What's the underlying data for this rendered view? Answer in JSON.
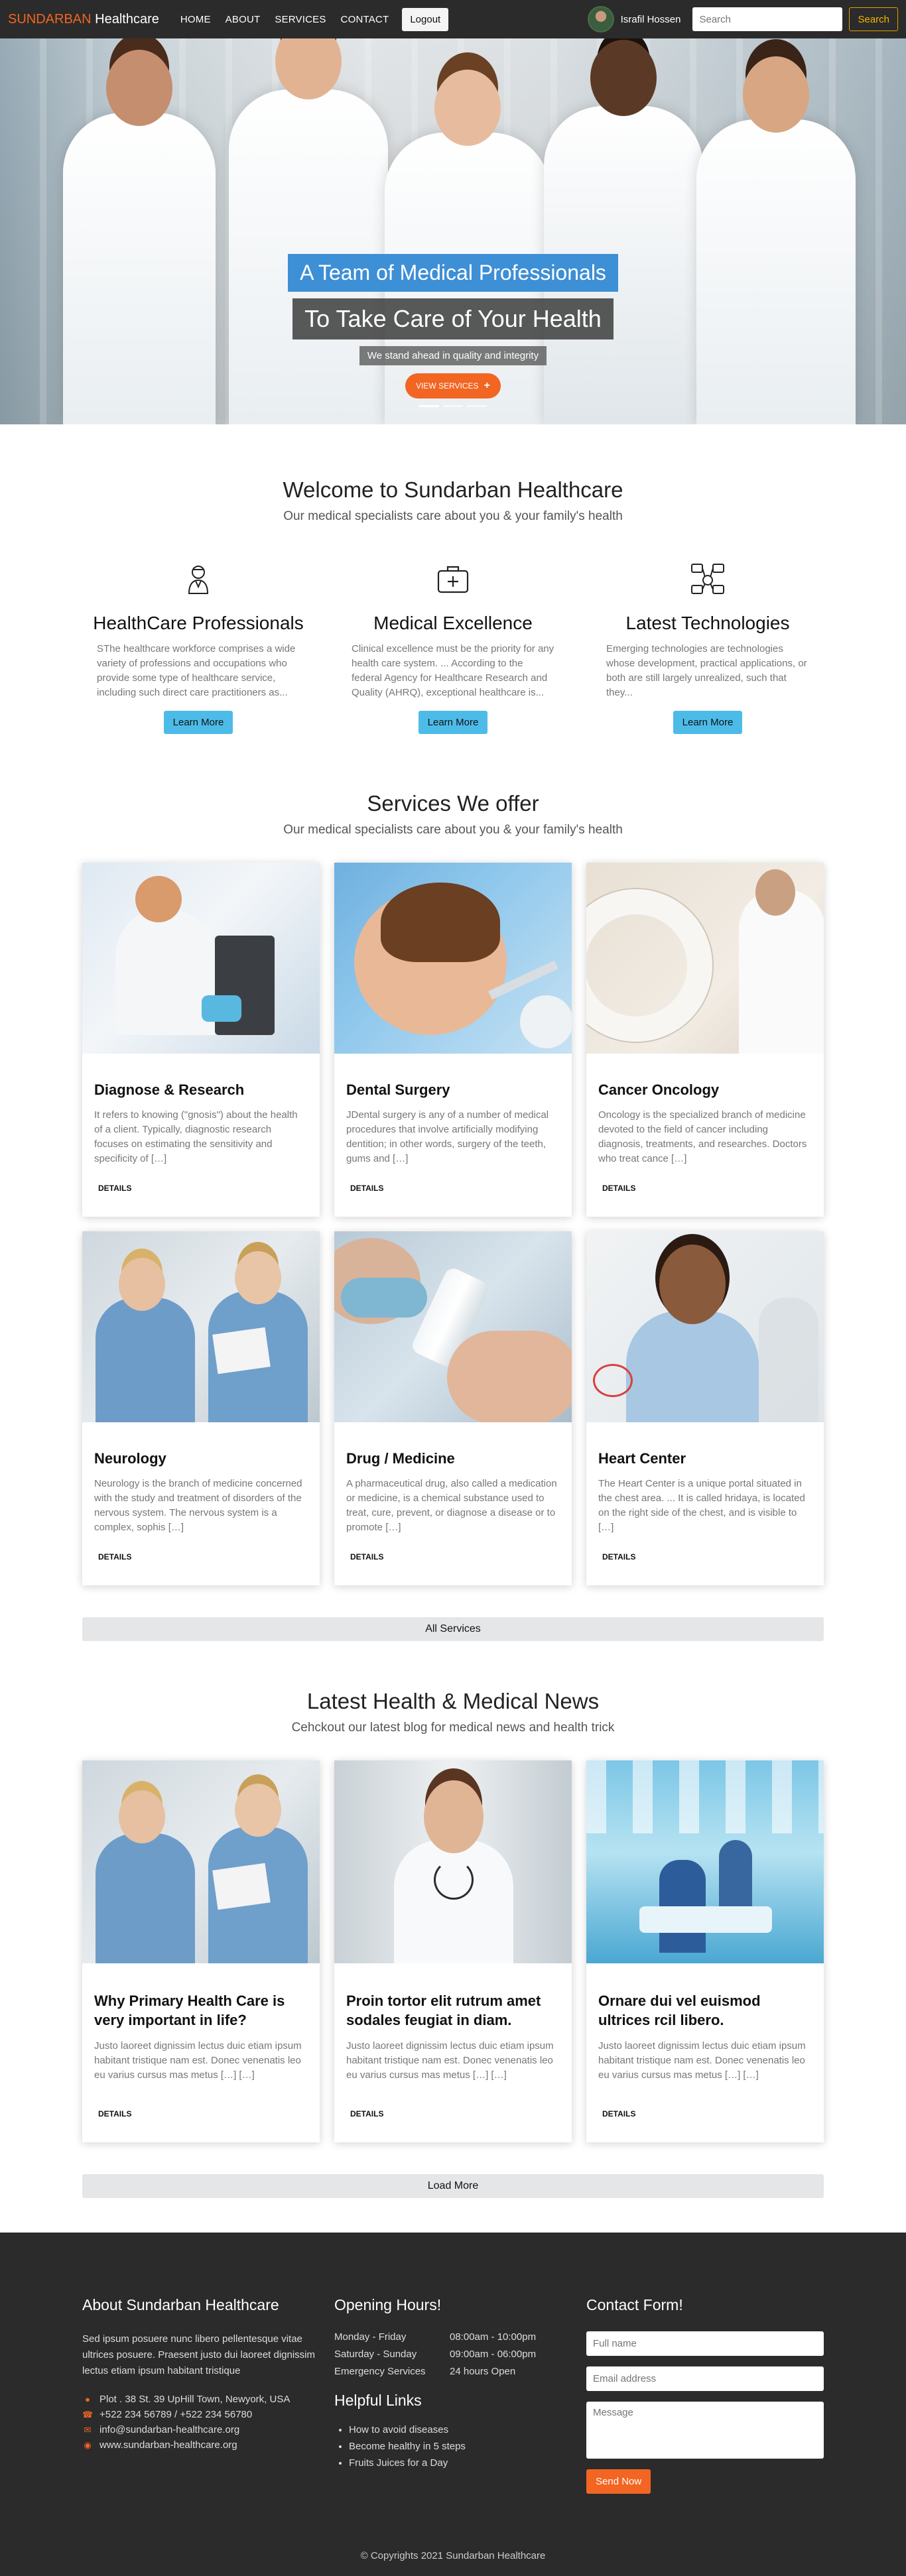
{
  "nav": {
    "brand_accent": "SUNDARBAN",
    "brand_rest": " Healthcare",
    "links": [
      "HOME",
      "ABOUT",
      "SERVICES",
      "CONTACT"
    ],
    "logout": "Logout",
    "user": "Israfil Hossen",
    "search_placeholder": "Search",
    "search_btn": "Search"
  },
  "hero": {
    "title": "A Team of Medical Professionals",
    "subtitle": "To Take Care of Your Health",
    "tagline": "We stand ahead in quality and integrity",
    "button": "VIEW SERVICES",
    "slides": 3,
    "active_slide": 1
  },
  "welcome": {
    "title": "Welcome to Sundarban Healthcare",
    "subtitle": "Our medical specialists care about you & your family's health",
    "features": [
      {
        "icon": "doctor-icon",
        "title": "HealthCare Professionals",
        "text": "SThe healthcare workforce comprises a wide variety of professions and occupations who provide some type of healthcare service, including such direct care practitioners as...",
        "button": "Learn More"
      },
      {
        "icon": "medical-kit-icon",
        "title": "Medical Excellence",
        "text": "Clinical excellence must be the priority for any health care system. ... According to the federal Agency for Healthcare Research and Quality (AHRQ), exceptional healthcare is...",
        "button": "Learn More"
      },
      {
        "icon": "technology-icon",
        "title": "Latest Technologies",
        "text": "Emerging technologies are technologies whose development, practical applications, or both are still largely unrealized, such that they...",
        "button": "Learn More"
      }
    ]
  },
  "services": {
    "title": "Services We offer",
    "subtitle": "Our medical specialists care about you & your family's health",
    "items": [
      {
        "title": "Diagnose & Research",
        "text": "It refers to knowing (\"gnosis\") about the health of a client. Typically, diagnostic research focuses on estimating the sensitivity and specificity of […]",
        "button": "DETAILS"
      },
      {
        "title": "Dental Surgery",
        "text": "JDental surgery is any of a number of medical procedures that involve artificially modifying dentition; in other words, surgery of the teeth, gums and […]",
        "button": "DETAILS"
      },
      {
        "title": "Cancer Oncology",
        "text": "Oncology is the specialized branch of medicine devoted to the field of cancer including diagnosis, treatments, and researches. Doctors who treat cance […]",
        "button": "DETAILS"
      },
      {
        "title": "Neurology",
        "text": "Neurology is the branch of medicine concerned with the study and treatment of disorders of the nervous system. The nervous system is a complex, sophis […]",
        "button": "DETAILS"
      },
      {
        "title": "Drug / Medicine",
        "text": "A pharmaceutical drug, also called a medication or medicine, is a chemical substance used to treat, cure, prevent, or diagnose a disease or to promote […]",
        "button": "DETAILS"
      },
      {
        "title": "Heart Center",
        "text": "The Heart Center is a unique portal situated in the chest area. ... It is called hridaya, is located on the right side of the chest, and is visible to […]",
        "button": "DETAILS"
      }
    ],
    "all_button": "All Services"
  },
  "news": {
    "title": "Latest Health & Medical News",
    "subtitle": "Cehckout our latest blog for medical news and health trick",
    "items": [
      {
        "title": "Why Primary Health Care is very important in life?",
        "text": "Justo laoreet dignissim lectus duic etiam ipsum habitant tristique nam est. Donec venenatis leo eu varius cursus mas metus […] […]",
        "button": "DETAILS"
      },
      {
        "title": "Proin tortor elit rutrum amet sodales feugiat in diam.",
        "text": "Justo laoreet dignissim lectus duic etiam ipsum habitant tristique nam est. Donec venenatis leo eu varius cursus mas metus […] […]",
        "button": "DETAILS"
      },
      {
        "title": "Ornare dui vel euismod ultrices rcil libero.",
        "text": "Justo laoreet dignissim lectus duic etiam ipsum habitant tristique nam est. Donec venenatis leo eu varius cursus mas metus […] […]",
        "button": "DETAILS"
      }
    ],
    "load_more": "Load More"
  },
  "footer": {
    "about_title": "About Sundarban Healthcare",
    "about_text": "Sed ipsum posuere nunc libero pellentesque vitae ultrices posuere. Praesent justo dui laoreet dignissim lectus etiam ipsum habitant tristique",
    "address": "Plot . 38 St. 39 UpHill Town, Newyork, USA",
    "phone": "+522 234 56789 / +522 234 56780",
    "email": "info@sundarban-healthcare.org",
    "website": "www.sundarban-healthcare.org",
    "hours_title": "Opening Hours!",
    "hours": [
      {
        "day": "Monday - Friday",
        "time": "08:00am - 10:00pm"
      },
      {
        "day": "Saturday - Sunday",
        "time": "09:00am - 06:00pm"
      },
      {
        "day": "Emergency Services",
        "time": "24 hours Open"
      }
    ],
    "links_title": "Helpful Links",
    "links": [
      "How to avoid diseases",
      "Become healthy in 5 steps",
      "Fruits Juices for a Day"
    ],
    "contact_title": "Contact Form!",
    "name_placeholder": "Full name",
    "email_placeholder": "Email address",
    "message_placeholder": "Message",
    "send": "Send Now",
    "copyright": "© Copyrights 2021 Sundarban Healthcare"
  },
  "colors": {
    "accent": "#f26522",
    "info": "#4dbbe8",
    "hero_title_bg": "#3d8fd6",
    "dark": "#2b2b2b"
  }
}
